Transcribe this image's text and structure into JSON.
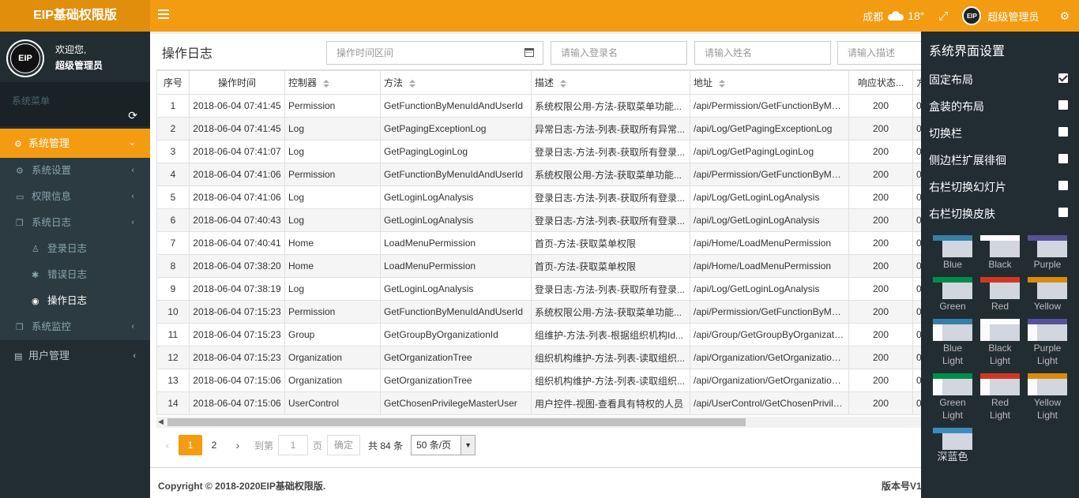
{
  "header": {
    "brand": "EIP基础权限版",
    "city": "成都",
    "temperature": "18°",
    "user_name": "超级管理员",
    "avatar_text": "EIP"
  },
  "sidebar": {
    "avatar_text": "EIP",
    "greeting": "欢迎您,",
    "user_name": "超级管理员",
    "menu_header": "系统菜单",
    "items": [
      {
        "label": "系统管理"
      },
      {
        "label": "系统设置"
      },
      {
        "label": "权限信息"
      },
      {
        "label": "系统日志"
      },
      {
        "label": "登录日志"
      },
      {
        "label": "错误日志"
      },
      {
        "label": "操作日志"
      },
      {
        "label": "系统监控"
      },
      {
        "label": "用户管理"
      }
    ]
  },
  "toolbar": {
    "title": "操作日志",
    "time_placeholder": "操作时间区间",
    "login_placeholder": "请输入登录名",
    "name_placeholder": "请输入姓名",
    "desc_placeholder": "请输入描述"
  },
  "table": {
    "columns": [
      "序号",
      "操作时间",
      "控制器",
      "方法",
      "描述",
      "地址",
      "响应状态...",
      "方"
    ],
    "rows": [
      [
        "1",
        "2018-06-04 07:41:45",
        "Permission",
        "GetFunctionByMenuIdAndUserId",
        "系统权限公用-方法-获取菜单功能...",
        "/api/Permission/GetFunctionByMen...",
        "200",
        "0"
      ],
      [
        "2",
        "2018-06-04 07:41:45",
        "Log",
        "GetPagingExceptionLog",
        "异常日志-方法-列表-获取所有异常...",
        "/api/Log/GetPagingExceptionLog",
        "200",
        "0"
      ],
      [
        "3",
        "2018-06-04 07:41:07",
        "Log",
        "GetPagingLoginLog",
        "登录日志-方法-列表-获取所有登录...",
        "/api/Log/GetPagingLoginLog",
        "200",
        "0"
      ],
      [
        "4",
        "2018-06-04 07:41:06",
        "Permission",
        "GetFunctionByMenuIdAndUserId",
        "系统权限公用-方法-获取菜单功能...",
        "/api/Permission/GetFunctionByMen...",
        "200",
        "0"
      ],
      [
        "5",
        "2018-06-04 07:41:06",
        "Log",
        "GetLoginLogAnalysis",
        "登录日志-方法-列表-获取所有登录...",
        "/api/Log/GetLoginLogAnalysis",
        "200",
        "0"
      ],
      [
        "6",
        "2018-06-04 07:40:43",
        "Log",
        "GetLoginLogAnalysis",
        "登录日志-方法-列表-获取所有登录...",
        "/api/Log/GetLoginLogAnalysis",
        "200",
        "0"
      ],
      [
        "7",
        "2018-06-04 07:40:41",
        "Home",
        "LoadMenuPermission",
        "首页-方法-获取菜单权限",
        "/api/Home/LoadMenuPermission",
        "200",
        "0"
      ],
      [
        "8",
        "2018-06-04 07:38:20",
        "Home",
        "LoadMenuPermission",
        "首页-方法-获取菜单权限",
        "/api/Home/LoadMenuPermission",
        "200",
        "0"
      ],
      [
        "9",
        "2018-06-04 07:38:19",
        "Log",
        "GetLoginLogAnalysis",
        "登录日志-方法-列表-获取所有登录...",
        "/api/Log/GetLoginLogAnalysis",
        "200",
        "0"
      ],
      [
        "10",
        "2018-06-04 07:15:23",
        "Permission",
        "GetFunctionByMenuIdAndUserId",
        "系统权限公用-方法-获取菜单功能...",
        "/api/Permission/GetFunctionByMen...",
        "200",
        "0"
      ],
      [
        "11",
        "2018-06-04 07:15:23",
        "Group",
        "GetGroupByOrganizationId",
        "组维护-方法-列表-根据组织机构Id...",
        "/api/Group/GetGroupByOrganizatio...",
        "200",
        "0"
      ],
      [
        "12",
        "2018-06-04 07:15:23",
        "Organization",
        "GetOrganizationTree",
        "组织机构维护-方法-列表-读取组织...",
        "/api/Organization/GetOrganizationT...",
        "200",
        "0"
      ],
      [
        "13",
        "2018-06-04 07:15:06",
        "Organization",
        "GetOrganizationTree",
        "组织机构维护-方法-列表-读取组织...",
        "/api/Organization/GetOrganizationT...",
        "200",
        "0"
      ],
      [
        "14",
        "2018-06-04 07:15:06",
        "UserControl",
        "GetChosenPrivilegeMasterUser",
        "用户控件-视图-查看具有特权的人员",
        "/api/UserControl/GetChosenPrivileg...",
        "200",
        "0"
      ]
    ]
  },
  "pager": {
    "pages": [
      "1",
      "2"
    ],
    "goto_label": "到第",
    "page_input": "1",
    "page_unit": "页",
    "confirm": "确定",
    "total": "共 84 条",
    "page_size": "50 条/页"
  },
  "footer": {
    "copyright": "Copyright © 2018-2020EIP基础权限版.",
    "version": "版本号V1."
  },
  "settings": {
    "title": "系统界面设置",
    "options": [
      {
        "label": "固定布局",
        "checked": true
      },
      {
        "label": "盒装的布局",
        "checked": false
      },
      {
        "label": "切换栏",
        "checked": false
      },
      {
        "label": "侧边栏扩展徘徊",
        "checked": false
      },
      {
        "label": "右栏切换幻灯片",
        "checked": false
      },
      {
        "label": "右栏切换皮肤",
        "checked": false
      }
    ],
    "skins": [
      {
        "label": "Blue",
        "color": "#367fa9"
      },
      {
        "label": "Black",
        "color": "#fefefe"
      },
      {
        "label": "Purple",
        "color": "#555299"
      },
      {
        "label": "Green",
        "color": "#008d4c"
      },
      {
        "label": "Red",
        "color": "#d33724"
      },
      {
        "label": "Yellow",
        "color": "#db8b0b"
      },
      {
        "label": "Blue Light",
        "color": "#367fa9"
      },
      {
        "label": "Black Light",
        "color": "#fefefe"
      },
      {
        "label": "Purple Light",
        "color": "#555299"
      },
      {
        "label": "Green Light",
        "color": "#008d4c"
      },
      {
        "label": "Red Light",
        "color": "#d33724"
      },
      {
        "label": "Yellow Light",
        "color": "#db8b0b"
      },
      {
        "label": "深蓝色",
        "color": "#3c8dbc"
      }
    ]
  },
  "colors": {
    "accent": "#f39c12",
    "sidebar_bg": "#222d32"
  }
}
